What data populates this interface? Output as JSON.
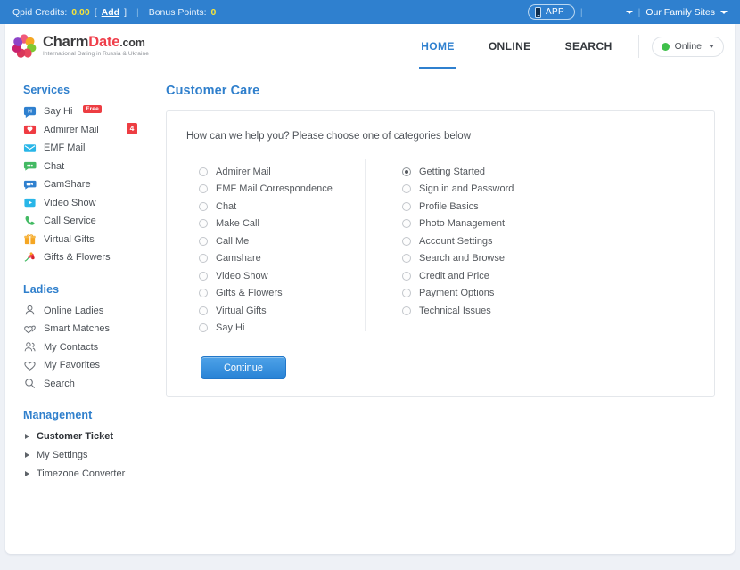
{
  "topbar": {
    "credits_label": "Qpid Credits:",
    "credits_value": "0.00",
    "bracket_open": "[",
    "add_label": "Add",
    "bracket_close": "]",
    "divider": "|",
    "bonus_label": "Bonus Points:",
    "bonus_value": "0",
    "app_label": "APP",
    "family_sites_label": "Our Family Sites",
    "accent_color": "#2f80cf",
    "value_color": "#f5e43c"
  },
  "header": {
    "logo_charm": "Charm",
    "logo_date": "Date",
    "logo_com": ".com",
    "logo_tagline": "International Dating in Russia & Ukraine",
    "nav": [
      {
        "label": "HOME",
        "active": true
      },
      {
        "label": "ONLINE",
        "active": false
      },
      {
        "label": "SEARCH",
        "active": false
      }
    ],
    "status_label": "Online",
    "status_color": "#3fc04a",
    "active_color": "#2f80cf"
  },
  "sidebar": {
    "services_heading": "Services",
    "services": [
      {
        "label": "Say Hi",
        "icon": "speech-bubble-icon",
        "badge": "Free"
      },
      {
        "label": "Admirer Mail",
        "icon": "envelope-heart-icon",
        "count": "4"
      },
      {
        "label": "EMF Mail",
        "icon": "mail-icon"
      },
      {
        "label": "Chat",
        "icon": "chat-icon"
      },
      {
        "label": "CamShare",
        "icon": "camera-bubble-icon"
      },
      {
        "label": "Video Show",
        "icon": "video-play-icon"
      },
      {
        "label": "Call Service",
        "icon": "phone-icon"
      },
      {
        "label": "Virtual Gifts",
        "icon": "gift-icon"
      },
      {
        "label": "Gifts & Flowers",
        "icon": "flowers-icon"
      }
    ],
    "ladies_heading": "Ladies",
    "ladies": [
      {
        "label": "Online Ladies",
        "icon": "person-icon"
      },
      {
        "label": "Smart Matches",
        "icon": "double-heart-icon"
      },
      {
        "label": "My Contacts",
        "icon": "people-icon"
      },
      {
        "label": "My Favorites",
        "icon": "heart-icon"
      },
      {
        "label": "Search",
        "icon": "search-icon"
      }
    ],
    "management_heading": "Management",
    "management": [
      {
        "label": "Customer Ticket",
        "active": true
      },
      {
        "label": "My Settings",
        "active": false
      },
      {
        "label": "Timezone Converter",
        "active": false
      }
    ],
    "heading_color": "#2f7fcc",
    "badge_color": "#ed3d42"
  },
  "main": {
    "title": "Customer Care",
    "lead": "How can we help you? Please choose one of categories below",
    "left_options": [
      {
        "label": "Admirer Mail",
        "selected": false
      },
      {
        "label": "EMF Mail Correspondence",
        "selected": false
      },
      {
        "label": "Chat",
        "selected": false
      },
      {
        "label": "Make Call",
        "selected": false
      },
      {
        "label": "Call Me",
        "selected": false
      },
      {
        "label": "Camshare",
        "selected": false
      },
      {
        "label": "Video Show",
        "selected": false
      },
      {
        "label": "Gifts & Flowers",
        "selected": false
      },
      {
        "label": "Virtual Gifts",
        "selected": false
      },
      {
        "label": "Say Hi",
        "selected": false
      }
    ],
    "right_options": [
      {
        "label": "Getting Started",
        "selected": true
      },
      {
        "label": "Sign in and Password",
        "selected": false
      },
      {
        "label": "Profile Basics",
        "selected": false
      },
      {
        "label": "Photo Management",
        "selected": false
      },
      {
        "label": "Account Settings",
        "selected": false
      },
      {
        "label": "Search and Browse",
        "selected": false
      },
      {
        "label": "Credit and Price",
        "selected": false
      },
      {
        "label": "Payment Options",
        "selected": false
      },
      {
        "label": "Technical Issues",
        "selected": false
      }
    ],
    "continue_label": "Continue"
  }
}
